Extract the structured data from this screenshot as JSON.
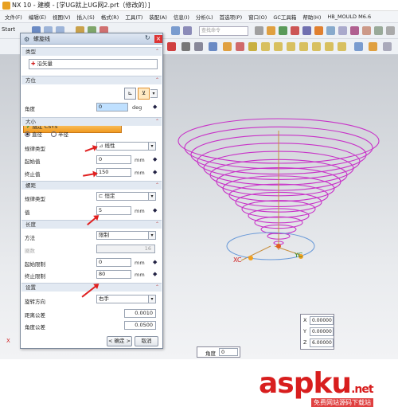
{
  "window": {
    "title": "NX 10 - 建模 - [学UG就上UG网2.prt（修改的）]"
  },
  "menu": [
    "文件(F)",
    "编辑(E)",
    "视图(V)",
    "插入(S)",
    "格式(R)",
    "工具(T)",
    "装配(A)",
    "信息(I)",
    "分析(L)",
    "首选项(P)",
    "窗口(O)",
    "GC工具箱",
    "帮助(H)",
    "HB_MOULD M6.6"
  ],
  "toolbar": {
    "start": "Start",
    "search_placeholder": "查找命令"
  },
  "dialog": {
    "title": "螺旋线",
    "sections": {
      "type": "类型",
      "orient": "方位",
      "size": "大小",
      "pitch": "螺距",
      "length": "长度",
      "settings": "设置"
    },
    "type_value": "沿矢量",
    "csys_label": "指定 CSYS",
    "angle_label": "角度",
    "angle_value": "0",
    "angle_unit": "deg",
    "size": {
      "diameter": "直径",
      "radius": "半径",
      "law_label": "规律类型",
      "law_value": "线性",
      "start_label": "起始值",
      "start_value": "0",
      "end_label": "终止值",
      "end_value": "150",
      "unit": "mm"
    },
    "pitch": {
      "law_label": "规律类型",
      "law_value": "恒定",
      "value_label": "值",
      "value": "5",
      "unit": "mm"
    },
    "length": {
      "method_label": "方法",
      "method_value": "限制",
      "count_label": "圈数",
      "count_value": "16",
      "start_label": "起始限制",
      "start_value": "0",
      "end_label": "终止限制",
      "end_value": "80",
      "unit": "mm"
    },
    "settings": {
      "direction_label": "旋转方向",
      "direction_value": "右手",
      "dist_tol_label": "距离公差",
      "dist_tol_value": "0.0010",
      "angle_tol_label": "角度公差",
      "angle_tol_value": "0.0500"
    },
    "ok": "< 确定 >",
    "cancel": "取消"
  },
  "viewport": {
    "axis_xc": "XC",
    "axis_yc": "YC",
    "coords": [
      {
        "label": "X",
        "value": "0.00000"
      },
      {
        "label": "Y",
        "value": "0.00000"
      },
      {
        "label": "Z",
        "value": "6.00000"
      }
    ],
    "angle_label": "角度",
    "angle_value": "0",
    "corner_x": "X"
  },
  "watermark": {
    "brand": "aspku",
    "tld": ".net",
    "slogan": "免费网站源码下载站"
  },
  "colors": {
    "helix": "#c832c8",
    "accent_orange": "#f09a20",
    "arrow_red": "#e02020"
  }
}
